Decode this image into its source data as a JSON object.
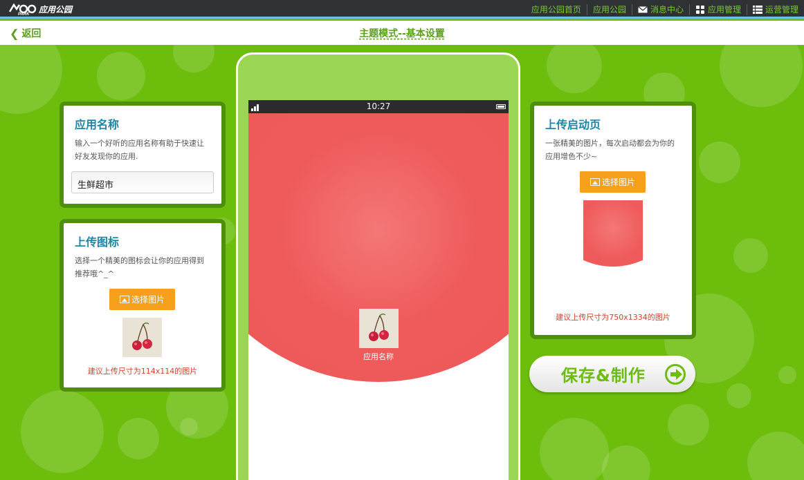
{
  "topbar": {
    "logo_text": "应用公园",
    "nav": [
      {
        "label": "应用公园首页",
        "icon": ""
      },
      {
        "label": "应用公园",
        "icon": ""
      },
      {
        "label": "消息中心",
        "icon": "mail-icon"
      },
      {
        "label": "应用管理",
        "icon": "grid-icon"
      },
      {
        "label": "运营管理",
        "icon": "list-icon"
      }
    ]
  },
  "subheader": {
    "back_label": "返回",
    "title": "主题模式--基本设置"
  },
  "app_name_card": {
    "title": "应用名称",
    "desc": "输入一个好听的应用名称有助于快速让好友发现你的应用.",
    "input_value": "生鲜超市"
  },
  "icon_card": {
    "title": "上传图标",
    "desc": "选择一个精美的图标会让你的应用得到推荐哦^_^",
    "button": "选择图片",
    "hint": "建议上传尺寸为114x114的图片"
  },
  "splash_card": {
    "title": "上传启动页",
    "desc": "一张精美的图片，每次启动都会为你的应用增色不少~",
    "button": "选择图片",
    "hint": "建议上传尺寸为750x1334的图片"
  },
  "phone": {
    "time": "10:27",
    "app_name": "应用名称"
  },
  "save_button": "保存&制作",
  "colors": {
    "background": "#6cbd0c",
    "accent_orange": "#f7a01c",
    "splash_red": "#ee5959",
    "title_blue": "#1d86a8",
    "hint_red": "#d2412f"
  }
}
